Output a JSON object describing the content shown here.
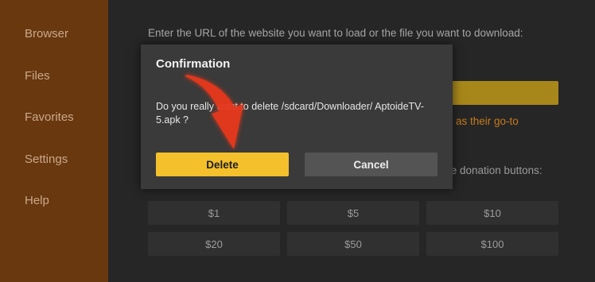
{
  "sidebar": {
    "items": [
      {
        "label": "Browser"
      },
      {
        "label": "Files"
      },
      {
        "label": "Favorites"
      },
      {
        "label": "Settings"
      },
      {
        "label": "Help"
      }
    ]
  },
  "main": {
    "prompt": "Enter the URL of the website you want to load or the file you want to download:",
    "orange_text": "as their go-to",
    "donation_text": "se donation buttons:",
    "donations": [
      "$1",
      "$5",
      "$10",
      "$20",
      "$50",
      "$100"
    ]
  },
  "dialog": {
    "title": "Confirmation",
    "message": "Do you really want to delete /sdcard/Downloader/ AptoideTV-5.apk ?",
    "delete_label": "Delete",
    "cancel_label": "Cancel"
  },
  "colors": {
    "sidebar": "#6a380e",
    "accent": "#f4c02c",
    "arrow": "#e8371c"
  },
  "annotation": {
    "icon": "red-arrow-icon"
  }
}
